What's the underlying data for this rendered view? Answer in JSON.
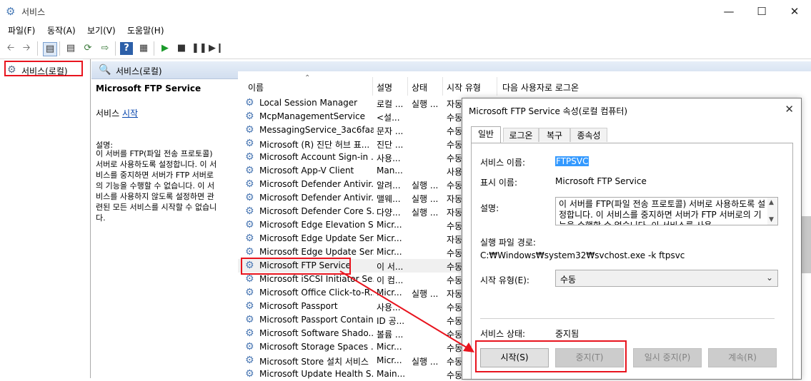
{
  "window": {
    "title": "서비스",
    "icon": "gear-icon",
    "controls": [
      "minimize-icon",
      "maximize-icon",
      "close-icon"
    ]
  },
  "menu": [
    "파일(F)",
    "동작(A)",
    "보기(V)",
    "도움말(H)"
  ],
  "toolbar": [
    "back-icon",
    "forward-icon",
    "console-tree-icon",
    "properties-icon",
    "refresh-icon",
    "export-icon",
    "help-icon",
    "view-icon",
    "play-icon",
    "stop-icon",
    "pause-icon",
    "restart-icon"
  ],
  "tree": {
    "item": "서비스(로컬)"
  },
  "right_header": "서비스(로컬)",
  "description_panel": {
    "service_name": "Microsoft FTP Service",
    "start_prefix": "서비스",
    "start_link": "시작",
    "desc_label": "설명:",
    "desc_text": "이 서버를 FTP(파일 전송 프로토콜)\n서버로 사용하도록 설정합니다. 이 서\n비스를 중지하면 서버가 FTP 서버로\n의 기능을 수행할 수 없습니다. 이 서\n비스를 사용하지 않도록 설정하면 관\n련된 모든 서비스를 시작할 수 없습니\n다."
  },
  "list": {
    "columns": [
      "이름",
      "설명",
      "상태",
      "시작 유형",
      "다음 사용자로 로그온"
    ],
    "rows": [
      {
        "name": "Local Session Manager",
        "desc": "로컬 ...",
        "status": "실행 ...",
        "type": "자동"
      },
      {
        "name": "McpManagementService",
        "desc": "<설...",
        "status": "",
        "type": "수동"
      },
      {
        "name": "MessagingService_3ac6faa",
        "desc": "문자 ...",
        "status": "",
        "type": "수동"
      },
      {
        "name": "Microsoft (R) 진단 허브 표...",
        "desc": "진단 ...",
        "status": "",
        "type": "수동"
      },
      {
        "name": "Microsoft Account Sign-in ...",
        "desc": "사용...",
        "status": "",
        "type": "수동"
      },
      {
        "name": "Microsoft App-V Client",
        "desc": "Man...",
        "status": "",
        "type": "사용"
      },
      {
        "name": "Microsoft Defender Antivir...",
        "desc": "알려...",
        "status": "실행 ...",
        "type": "수동"
      },
      {
        "name": "Microsoft Defender Antivir...",
        "desc": "맬웨...",
        "status": "실행 ...",
        "type": "자동"
      },
      {
        "name": "Microsoft Defender Core S...",
        "desc": "다양...",
        "status": "실행 ...",
        "type": "자동"
      },
      {
        "name": "Microsoft Edge Elevation S...",
        "desc": "Micr...",
        "status": "",
        "type": "수동"
      },
      {
        "name": "Microsoft Edge Update Ser...",
        "desc": "Micr...",
        "status": "",
        "type": "자동"
      },
      {
        "name": "Microsoft Edge Update Ser...",
        "desc": "Micr...",
        "status": "",
        "type": "수동"
      },
      {
        "name": "Microsoft FTP Service",
        "desc": "이 서...",
        "status": "",
        "type": "수동"
      },
      {
        "name": "Microsoft iSCSI Initiator Se...",
        "desc": "이 컴...",
        "status": "",
        "type": "수동"
      },
      {
        "name": "Microsoft Office Click-to-R...",
        "desc": "Micr...",
        "status": "실행 ...",
        "type": "자동"
      },
      {
        "name": "Microsoft Passport",
        "desc": "사용...",
        "status": "",
        "type": "수동"
      },
      {
        "name": "Microsoft Passport Container",
        "desc": "ID 공...",
        "status": "",
        "type": "수동"
      },
      {
        "name": "Microsoft Software Shado...",
        "desc": "볼륨 ...",
        "status": "",
        "type": "수동"
      },
      {
        "name": "Microsoft Storage Spaces ...",
        "desc": "Micr...",
        "status": "",
        "type": "수동"
      },
      {
        "name": "Microsoft Store 설치 서비스",
        "desc": "Micr...",
        "status": "실행 ...",
        "type": "수동"
      },
      {
        "name": "Microsoft Update Health S...",
        "desc": "Main...",
        "status": "",
        "type": "수동"
      }
    ]
  },
  "dialog": {
    "title": "Microsoft FTP Service 속성(로컬 컴퓨터)",
    "tabs": [
      "일반",
      "로그온",
      "복구",
      "종속성"
    ],
    "service_name_label": "서비스 이름:",
    "service_name_value": "FTPSVC",
    "display_name_label": "표시 이름:",
    "display_name_value": "Microsoft FTP Service",
    "desc_label": "설명:",
    "desc_value": "이 서버를 FTP(파일 전송 프로토콜) 서버로 사용하도록 설정합니다. 이 서비스를 중지하면 서버가 FTP 서버로의 기능을 수행할 수 없습니다. 이 서비스를 사용",
    "path_label": "실행 파일 경로:",
    "path_value": "C:₩Windows₩system32₩svchost.exe -k ftpsvc",
    "start_type_label": "시작 유형(E):",
    "start_type_value": "수동",
    "status_label": "서비스 상태:",
    "status_value": "중지됨",
    "buttons": {
      "start": "시작(S)",
      "stop": "중지(T)",
      "pause": "일시 중지(P)",
      "resume": "계속(R)"
    }
  }
}
